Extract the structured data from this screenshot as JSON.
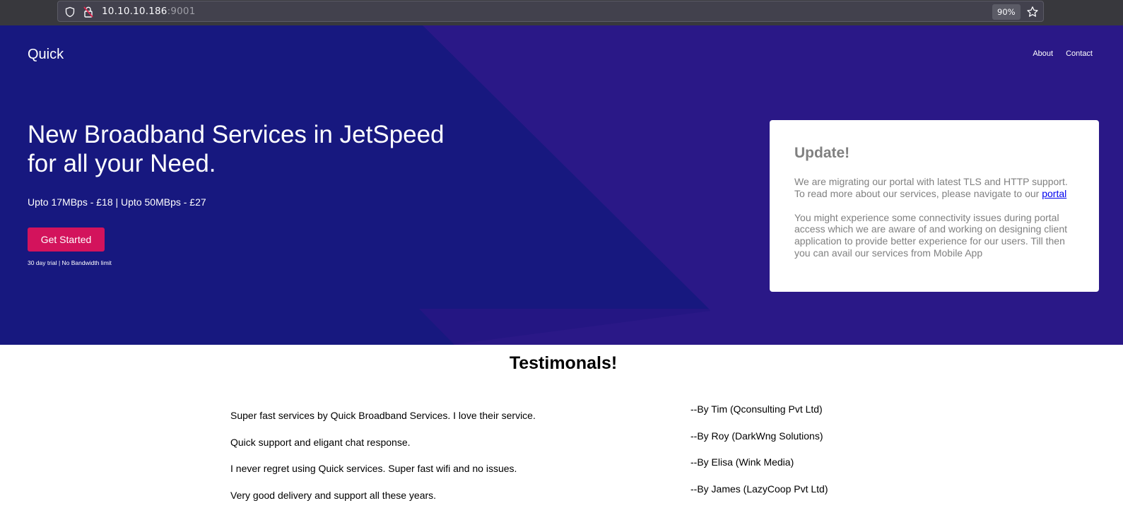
{
  "browser": {
    "url_host": "10.10.10.186",
    "url_port": ":9001",
    "zoom": "90%",
    "icons": [
      "shield-icon",
      "lock-icon",
      "star-icon"
    ]
  },
  "site": {
    "brand": "Quick",
    "nav": [
      {
        "label": "About"
      },
      {
        "label": "Contact"
      }
    ]
  },
  "hero": {
    "headline_line1": "New Broadband Services in JetSpeed",
    "headline_line2": "for all your Need.",
    "pricing": "Upto 17MBps - £18 | Upto 50MBps - £27",
    "cta_label": "Get Started",
    "trial_note": "30 day trial | No Bandwidth limit"
  },
  "update_card": {
    "title": "Update!",
    "para1_text": "We are migrating our portal with latest TLS and HTTP support. To read more about our services, please navigate to our ",
    "para1_link": "portal",
    "para2": "You might experience some connectivity issues during portal access which we are aware of and working on designing client application to provide better experience for our users. Till then you can avail our services from Mobile App"
  },
  "testimonials": {
    "title": "Testimonals!",
    "quotes": [
      "Super fast services by Quick Broadband Services. I love their service.",
      "Quick support and eligant chat response.",
      "I never regret using Quick services. Super fast wifi and no issues.",
      "Very good delivery and support all these years."
    ],
    "authors": [
      "--By Tim (Qconsulting Pvt Ltd)",
      "--By Roy (DarkWng Solutions)",
      "--By Elisa (Wink Media)",
      "--By James (LazyCoop Pvt Ltd)"
    ]
  },
  "colors": {
    "hero_bg": "#2a1887",
    "hero_dark": "#17187f",
    "cta": "#d3135c",
    "card_text": "#808080"
  }
}
